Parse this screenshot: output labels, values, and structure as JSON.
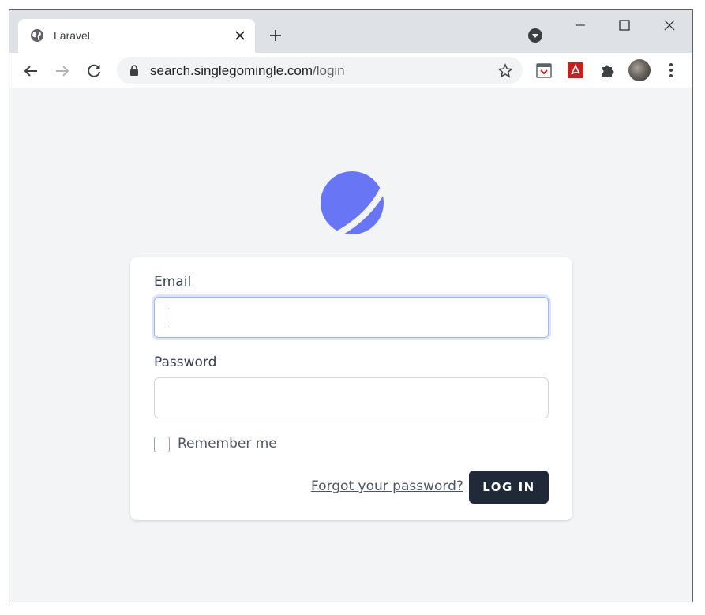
{
  "browser": {
    "tab_title": "Laravel",
    "url_host": "search.singlegomingle.com",
    "url_path": "/login"
  },
  "icons": {
    "tab_favicon": "globe-icon",
    "tab_close": "close-icon",
    "new_tab": "plus-icon",
    "tab_search": "chevron-down-icon",
    "minimize": "minimize-icon",
    "maximize": "maximize-icon",
    "window_close": "close-icon",
    "back": "arrow-left-icon",
    "forward": "arrow-right-icon",
    "reload": "reload-icon",
    "lock": "lock-icon",
    "bookmark": "star-icon",
    "ext_1": "calendar-extension-icon",
    "ext_2": "pdf-extension-icon",
    "extensions": "puzzle-icon",
    "menu": "kebab-icon"
  },
  "login": {
    "email_label": "Email",
    "email_value": "",
    "password_label": "Password",
    "password_value": "",
    "remember_label": "Remember me",
    "remember_checked": false,
    "forgot_link": "Forgot your password?",
    "submit_label": "Log in"
  },
  "colors": {
    "accent": "#6875f5",
    "button": "#1f2937",
    "background": "#f3f4f6"
  }
}
